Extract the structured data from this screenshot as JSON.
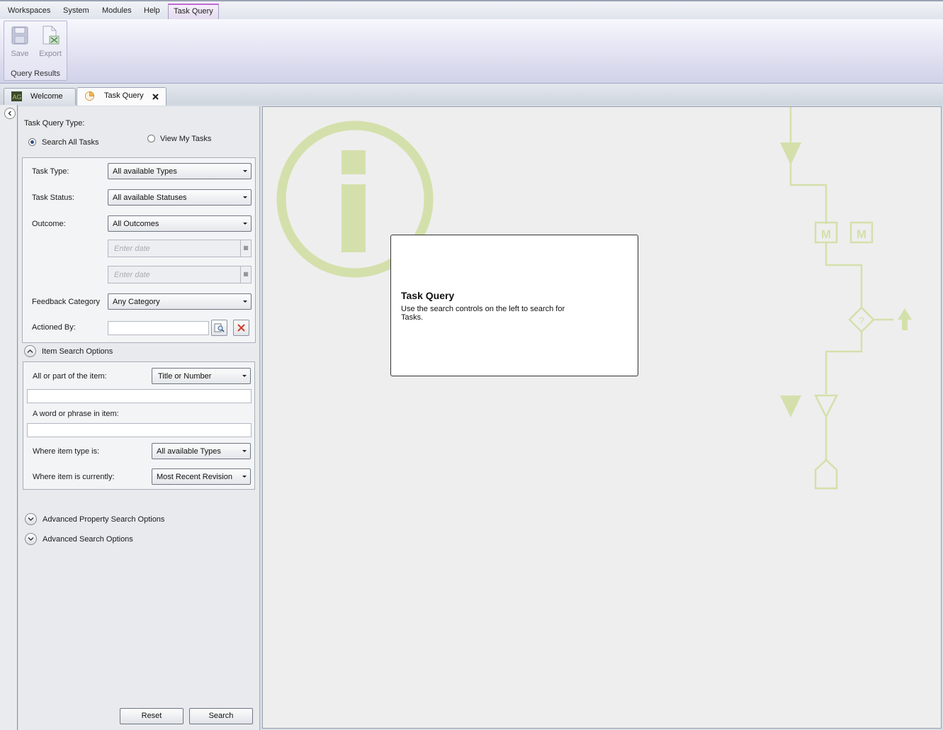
{
  "menu": {
    "items": [
      "Workspaces",
      "System",
      "Modules",
      "Help"
    ],
    "active_tab": "Task Query"
  },
  "ribbon": {
    "save_label": "Save",
    "export_label": "Export",
    "group_label": "Query Results"
  },
  "tabs": [
    {
      "label": "Welcome",
      "icon": "app-logo-icon",
      "active": false
    },
    {
      "label": "Task Query",
      "icon": "pie-chart-icon",
      "active": true,
      "closable": true
    }
  ],
  "search_panel": {
    "query_type_label": "Task Query Type:",
    "radio_all_label": "Search All Tasks",
    "radio_all_selected": true,
    "radio_mine_label": "View My Tasks",
    "radio_mine_selected": false,
    "task_type_label": "Task Type:",
    "task_type_value": "All available Types",
    "task_status_label": "Task Status:",
    "task_status_value": "All available Statuses",
    "outcome_label": "Outcome:",
    "outcome_value": "All Outcomes",
    "date_from_placeholder": "Enter date",
    "date_to_placeholder": "Enter date",
    "feedback_category_label": "Feedback Category",
    "feedback_category_value": "Any Category",
    "actioned_by_label": "Actioned By:",
    "actioned_by_value": "",
    "item_search_options_label": "Item Search Options",
    "item_part_label": "All or part of the item:",
    "item_part_value": "Title or Number",
    "item_part_text": "",
    "word_phrase_label": "A word or phrase in item:",
    "word_phrase_text": "",
    "item_type_label": "Where item type is:",
    "item_type_value": "All available Types",
    "item_current_label": "Where item is currently:",
    "item_current_value": "Most Recent Revision",
    "advanced_property_label": "Advanced Property Search Options",
    "advanced_search_label": "Advanced Search Options",
    "reset_label": "Reset",
    "search_label": "Search"
  },
  "content": {
    "info_title": "Task Query",
    "info_text": "Use the search controls on the left to search for Tasks.",
    "watermark_color": "#d3e0a8"
  }
}
